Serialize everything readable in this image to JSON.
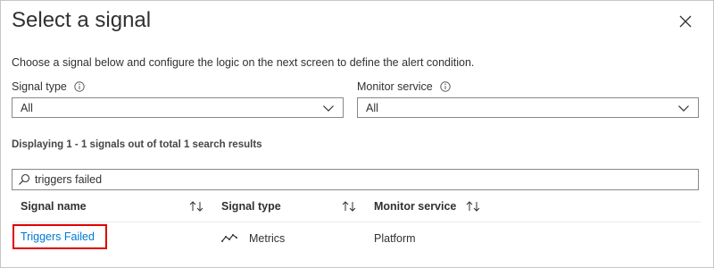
{
  "dialog": {
    "title": "Select a signal",
    "description": "Choose a signal below and configure the logic on the next screen to define the alert condition."
  },
  "filters": {
    "signal_type_label": "Signal type",
    "signal_type_value": "All",
    "monitor_service_label": "Monitor service",
    "monitor_service_value": "All"
  },
  "results": {
    "summary": "Displaying 1 - 1 signals out of total 1 search results"
  },
  "search": {
    "value": "triggers failed"
  },
  "table": {
    "columns": [
      "Signal name",
      "Signal type",
      "Monitor service"
    ],
    "rows": [
      {
        "signal_name": "Triggers Failed",
        "signal_type": "Metrics",
        "monitor_service": "Platform"
      }
    ]
  },
  "colors": {
    "link": "#0078d4",
    "highlight": "#e00000"
  }
}
